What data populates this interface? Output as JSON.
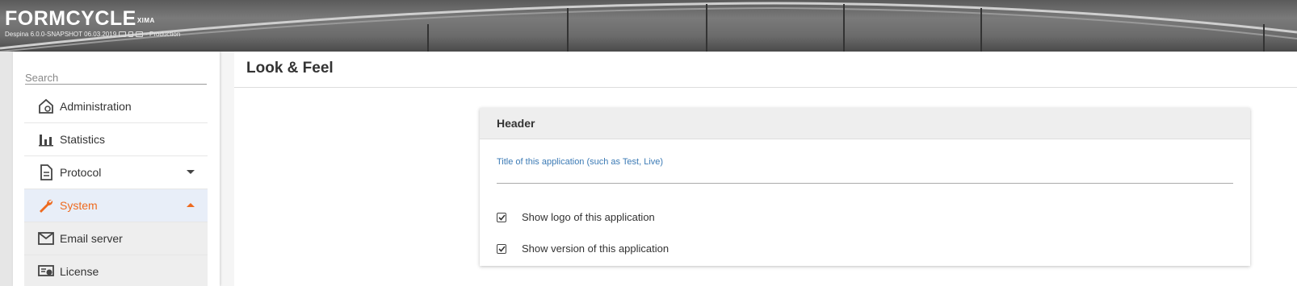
{
  "header": {
    "brand": "FORMCYCLE",
    "brand_sup": "XIMA",
    "version_info": "Despina 6.0.0-SNAPSHOT 06.03.2019",
    "environment": "- Production"
  },
  "sidebar": {
    "search_placeholder": "Search",
    "items": [
      {
        "label": "Administration",
        "icon": "admin-house-icon"
      },
      {
        "label": "Statistics",
        "icon": "bar-chart-icon"
      },
      {
        "label": "Protocol",
        "icon": "document-icon",
        "expandable": true
      },
      {
        "label": "System",
        "icon": "wrench-icon",
        "expanded": true,
        "active": true
      },
      {
        "label": "Email server",
        "icon": "envelope-icon"
      },
      {
        "label": "License",
        "icon": "license-badge-icon"
      }
    ]
  },
  "main": {
    "page_title": "Look & Feel",
    "panel": {
      "title": "Header",
      "title_field_label": "Title of this application (such as Test, Live)",
      "title_field_value": "",
      "options": [
        {
          "label": "Show logo of this application",
          "checked": true
        },
        {
          "label": "Show version of this application",
          "checked": true
        }
      ]
    }
  },
  "colors": {
    "accent": "#ee6a1f",
    "link": "#3b7ab5",
    "active_bg": "#e8eef8"
  }
}
